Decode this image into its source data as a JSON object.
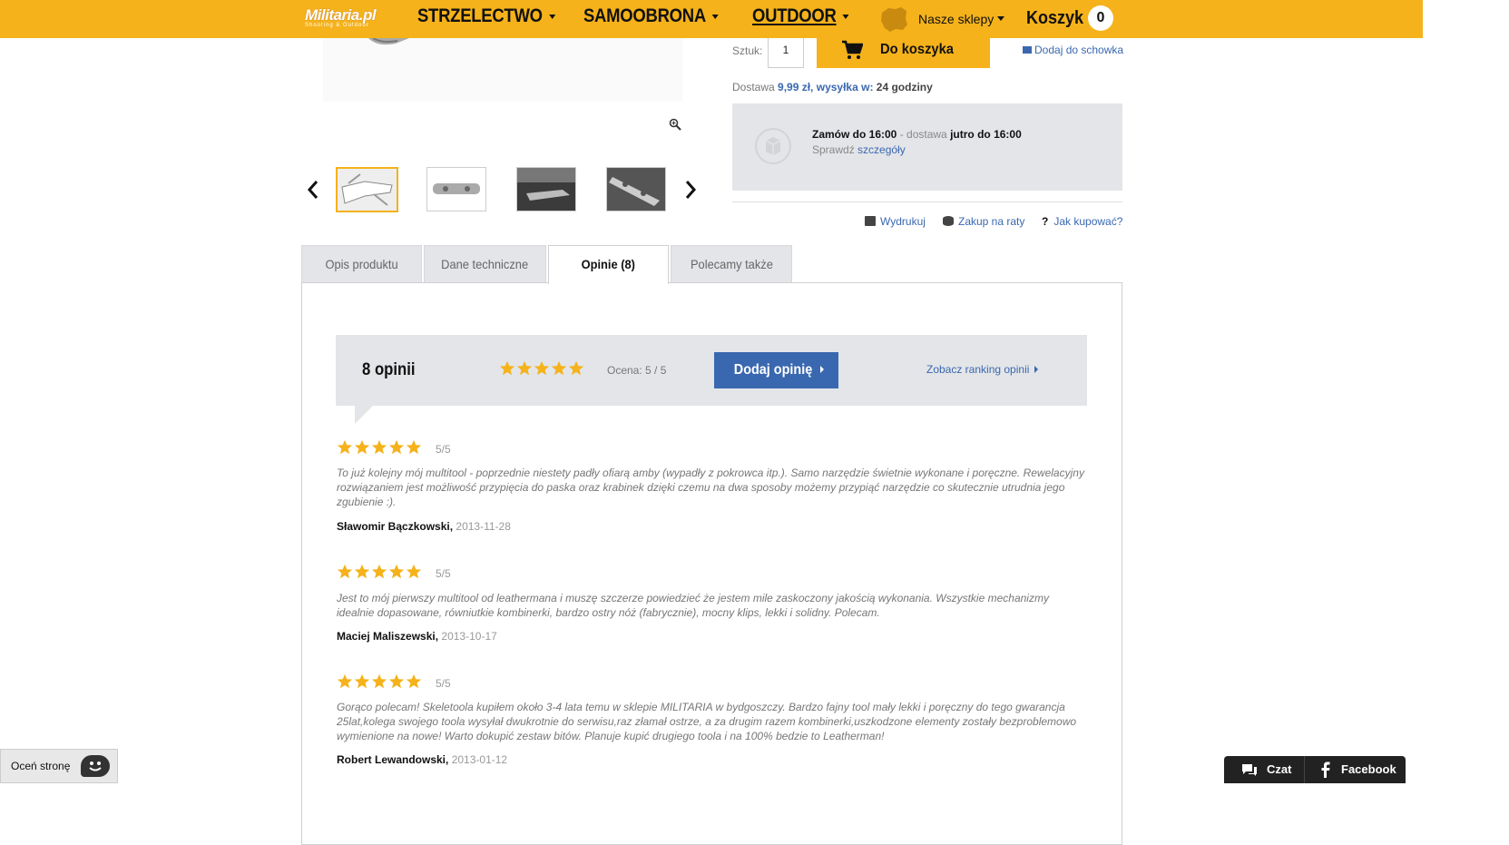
{
  "header": {
    "logo_text": "Militaria.pl",
    "logo_subtitle": "Shooting & Outdoor",
    "nav": [
      {
        "label": "STRZELECTWO"
      },
      {
        "label": "SAMOOBRONA"
      },
      {
        "label": "OUTDOOR"
      }
    ],
    "shops_label": "Nasze sklepy",
    "cart_label": "Koszyk",
    "cart_count": "0",
    "accent_color": "#f5b21a"
  },
  "buy_box": {
    "qty_label": "Sztuk:",
    "qty_value": "1",
    "add_to_cart_label": "Do koszyka",
    "wishlist_label": "Dodaj do schowka",
    "delivery_prefix": "Dostawa",
    "delivery_price": "9,99 zł,",
    "shipping_prefix": "wysyłka w:",
    "shipping_time": "24 godziny",
    "order_by": "Zamów do 16:00",
    "order_sep": "- dostawa",
    "delivery_when": "jutro do 16:00",
    "check_prefix": "Sprawdź",
    "check_link": "szczegóły"
  },
  "utility_links": {
    "print": "Wydrukuj",
    "installments": "Zakup na raty",
    "how_to_buy": "Jak kupować?"
  },
  "tabs": [
    {
      "label": "Opis produktu"
    },
    {
      "label": "Dane techniczne"
    },
    {
      "label": "Opinie (8)"
    },
    {
      "label": "Polecamy także"
    }
  ],
  "reviews_summary": {
    "count_label": "8 opinii",
    "rating_text": "Ocena: 5 / 5",
    "add_review_label": "Dodaj opinię",
    "ranking_link": "Zobacz ranking opinii"
  },
  "reviews": [
    {
      "score": "5/5",
      "body": "To już kolejny mój multitool - poprzednie niestety padły ofiarą amby (wypadły z pokrowca itp.). Samo narzędzie świetnie wykonane i poręczne. Rewelacyjny rozwiązaniem jest możliwość przypięcia do paska oraz krabinek dzięki czemu na dwa sposoby możemy przypiąć narzędzie co skutecznie utrudnia jego zgubienie :).",
      "author": "Sławomir Bączkowski,",
      "date": "2013-11-28"
    },
    {
      "score": "5/5",
      "body": "Jest to mój pierwszy multitool od leathermana i muszę szczerze powiedzieć że jestem mile zaskoczony jakością wykonania. Wszystkie mechanizmy idealnie dopasowane, równiutkie kombinerki, bardzo ostry nóż (fabrycznie), mocny klips, lekki i solidny. Polecam.",
      "author": "Maciej Maliszewski,",
      "date": "2013-10-17"
    },
    {
      "score": "5/5",
      "body": "Gorąco polecam! Skeletoola kupiłem około 3-4 lata temu w sklepie MILITARIA w bydgoszczy. Bardzo fajny tool mały lekki i poręczny do tego gwarancja 25lat,kolega swojego toola wysyłał dwukrotnie do serwisu,raz złamał ostrze, a za drugim razem kombinerki,uszkodzone elementy zostały bezproblemowo wymienione na nowe! Warto dokupić zestaw bitów. Planuje kupić drugiego toola i na 100% bedzie to Leatherman!",
      "author": "Robert Lewandowski,",
      "date": "2013-01-12"
    }
  ],
  "widgets": {
    "rate_page": "Oceń stronę",
    "chat": "Czat",
    "facebook": "Facebook"
  },
  "colors": {
    "link_blue": "#3a68b0",
    "star_gold": "#f5b21a",
    "panel_grey": "#e3e5e8"
  }
}
